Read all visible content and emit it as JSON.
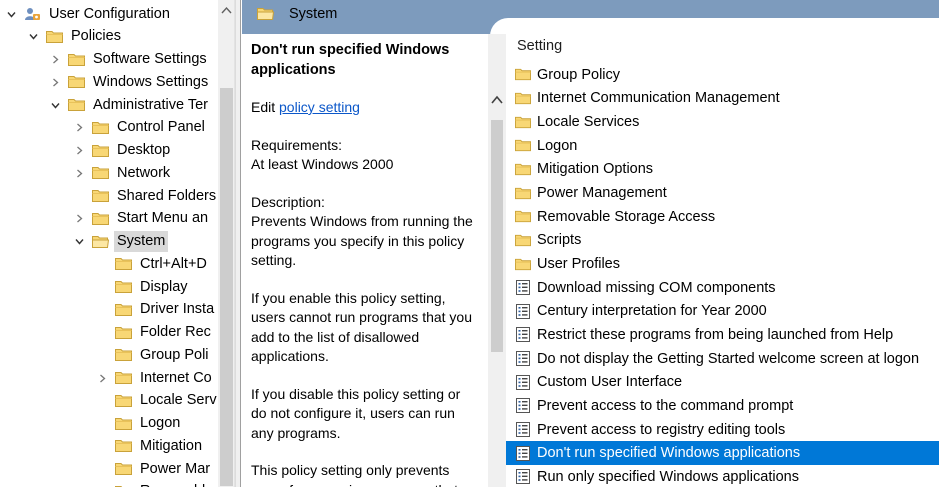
{
  "tree": {
    "items": [
      {
        "label": "User Configuration",
        "level": 0,
        "expander": "expanded",
        "icon": "user-config-icon"
      },
      {
        "label": "Policies",
        "level": 1,
        "expander": "expanded",
        "icon": "folder-icon"
      },
      {
        "label": "Software Settings",
        "level": 2,
        "expander": "collapsed",
        "icon": "folder-icon"
      },
      {
        "label": "Windows Settings",
        "level": 2,
        "expander": "collapsed",
        "icon": "folder-icon"
      },
      {
        "label": "Administrative Ter",
        "level": 2,
        "expander": "expanded",
        "icon": "folder-icon"
      },
      {
        "label": "Control Panel",
        "level": 3,
        "expander": "collapsed",
        "icon": "folder-icon"
      },
      {
        "label": "Desktop",
        "level": 3,
        "expander": "collapsed",
        "icon": "folder-icon"
      },
      {
        "label": "Network",
        "level": 3,
        "expander": "collapsed",
        "icon": "folder-icon"
      },
      {
        "label": "Shared Folders",
        "level": 3,
        "expander": "none",
        "icon": "folder-icon"
      },
      {
        "label": "Start Menu an",
        "level": 3,
        "expander": "collapsed",
        "icon": "folder-icon"
      },
      {
        "label": "System",
        "level": 3,
        "expander": "expanded",
        "icon": "folder-open-icon",
        "selected": true
      },
      {
        "label": "Ctrl+Alt+D",
        "level": 4,
        "expander": "none",
        "icon": "folder-icon"
      },
      {
        "label": "Display",
        "level": 4,
        "expander": "none",
        "icon": "folder-icon"
      },
      {
        "label": "Driver Insta",
        "level": 4,
        "expander": "none",
        "icon": "folder-icon"
      },
      {
        "label": "Folder Rec",
        "level": 4,
        "expander": "none",
        "icon": "folder-icon"
      },
      {
        "label": "Group Poli",
        "level": 4,
        "expander": "none",
        "icon": "folder-icon"
      },
      {
        "label": "Internet Co",
        "level": 4,
        "expander": "collapsed",
        "icon": "folder-icon"
      },
      {
        "label": "Locale Serv",
        "level": 4,
        "expander": "none",
        "icon": "folder-icon"
      },
      {
        "label": "Logon",
        "level": 4,
        "expander": "none",
        "icon": "folder-icon"
      },
      {
        "label": "Mitigation",
        "level": 4,
        "expander": "none",
        "icon": "folder-icon"
      },
      {
        "label": "Power Mar",
        "level": 4,
        "expander": "none",
        "icon": "folder-icon"
      },
      {
        "label": "Removabl",
        "level": 4,
        "expander": "none",
        "icon": "folder-icon"
      }
    ]
  },
  "header": {
    "title": "System",
    "icon": "folder-open-icon",
    "color": "#7d9bbd"
  },
  "description": {
    "title": "Don't run specified Windows applications",
    "edit_prefix": "Edit ",
    "edit_link": "policy setting ",
    "requirements_label": "Requirements:",
    "requirements_value": "At least Windows 2000",
    "description_label": "Description:",
    "paragraphs": [
      "Prevents Windows from running the programs you specify in this policy setting.",
      "If you enable this policy setting, users cannot run programs that you add to the list of disallowed applications.",
      "If you disable this policy setting or do not configure it, users can run any programs.",
      "This policy setting only prevents users from running programs that"
    ]
  },
  "settings": {
    "column_header": "Setting",
    "selected_color": "#0078d7",
    "items": [
      {
        "label": "Group Policy",
        "icon": "folder-icon"
      },
      {
        "label": "Internet Communication Management",
        "icon": "folder-icon"
      },
      {
        "label": "Locale Services",
        "icon": "folder-icon"
      },
      {
        "label": "Logon",
        "icon": "folder-icon"
      },
      {
        "label": "Mitigation Options",
        "icon": "folder-icon"
      },
      {
        "label": "Power Management",
        "icon": "folder-icon"
      },
      {
        "label": "Removable Storage Access",
        "icon": "folder-icon"
      },
      {
        "label": "Scripts",
        "icon": "folder-icon"
      },
      {
        "label": "User Profiles",
        "icon": "folder-icon"
      },
      {
        "label": "Download missing COM components",
        "icon": "policy-setting-icon"
      },
      {
        "label": "Century interpretation for Year 2000",
        "icon": "policy-setting-icon"
      },
      {
        "label": "Restrict these programs from being launched from Help",
        "icon": "policy-setting-icon"
      },
      {
        "label": "Do not display the Getting Started welcome screen at logon",
        "icon": "policy-setting-icon"
      },
      {
        "label": "Custom User Interface",
        "icon": "policy-setting-icon"
      },
      {
        "label": "Prevent access to the command prompt",
        "icon": "policy-setting-icon"
      },
      {
        "label": "Prevent access to registry editing tools",
        "icon": "policy-setting-icon"
      },
      {
        "label": "Don't run specified Windows applications",
        "icon": "policy-setting-icon",
        "selected": true
      },
      {
        "label": "Run only specified Windows applications",
        "icon": "policy-setting-icon"
      }
    ]
  }
}
